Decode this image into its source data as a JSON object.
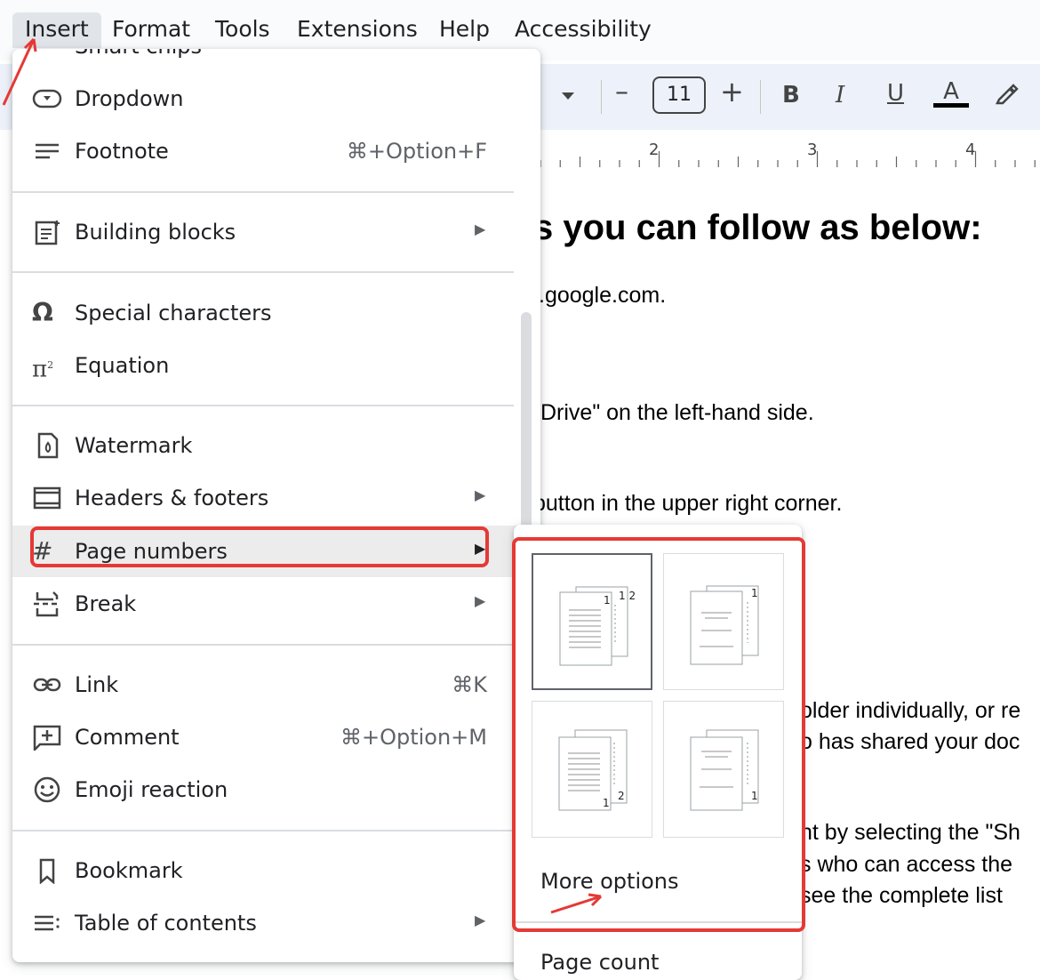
{
  "menubar": {
    "items": [
      "Insert",
      "Format",
      "Tools",
      "Extensions",
      "Help",
      "Accessibility"
    ]
  },
  "toolbar": {
    "font_size": "11",
    "minus": "–",
    "plus": "+",
    "bold": "B",
    "italic": "I",
    "underline": "U",
    "text_color": "A"
  },
  "ruler": {
    "labels": [
      "2",
      "3",
      "4"
    ]
  },
  "document": {
    "heading": "s you can follow as below:",
    "lines": [
      ".google.com.",
      "Drive\" on the left-hand side.",
      "button in the upper right corner.",
      "older individually, or re",
      "o has shared your doc",
      "nt by selecting the \"Sh",
      "s who can access the",
      "see the complete list"
    ]
  },
  "insert_menu": {
    "partial_top": "Smart chips",
    "items": [
      {
        "label": "Dropdown",
        "shortcut": "",
        "icon": "dropdown-icon",
        "submenu": false
      },
      {
        "label": "Footnote",
        "shortcut": "⌘+Option+F",
        "icon": "footnote-icon",
        "submenu": false
      },
      {
        "label": "Building blocks",
        "shortcut": "",
        "icon": "building-blocks-icon",
        "submenu": true
      },
      {
        "label": "Special characters",
        "shortcut": "",
        "icon": "omega-icon",
        "submenu": false
      },
      {
        "label": "Equation",
        "shortcut": "",
        "icon": "pi-icon",
        "submenu": false
      },
      {
        "label": "Watermark",
        "shortcut": "",
        "icon": "watermark-icon",
        "submenu": false
      },
      {
        "label": "Headers & footers",
        "shortcut": "",
        "icon": "headers-footers-icon",
        "submenu": true
      },
      {
        "label": "Page numbers",
        "shortcut": "",
        "icon": "hash-icon",
        "submenu": true
      },
      {
        "label": "Break",
        "shortcut": "",
        "icon": "break-icon",
        "submenu": true
      },
      {
        "label": "Link",
        "shortcut": "⌘K",
        "icon": "link-icon",
        "submenu": false
      },
      {
        "label": "Comment",
        "shortcut": "⌘+Option+M",
        "icon": "comment-icon",
        "submenu": false
      },
      {
        "label": "Emoji reaction",
        "shortcut": "",
        "icon": "emoji-icon",
        "submenu": false
      },
      {
        "label": "Bookmark",
        "shortcut": "",
        "icon": "bookmark-icon",
        "submenu": false
      },
      {
        "label": "Table of contents",
        "shortcut": "",
        "icon": "toc-icon",
        "submenu": true
      }
    ]
  },
  "page_numbers_submenu": {
    "options": [
      {
        "name": "header-all-pages",
        "marker": "1 2"
      },
      {
        "name": "header-skip-first",
        "marker": "1"
      },
      {
        "name": "footer-all-pages",
        "marker": "1 2"
      },
      {
        "name": "footer-skip-first",
        "marker": "1"
      }
    ],
    "more_options": "More options",
    "page_count": "Page count"
  },
  "colors": {
    "highlight": "#e53935",
    "menubar_bg": "#f9fbfd",
    "toolbar_bg": "#edf2fa"
  }
}
